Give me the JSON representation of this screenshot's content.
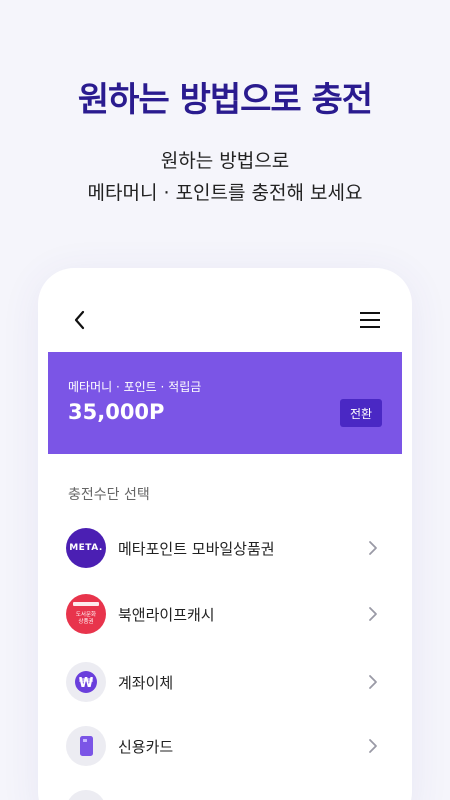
{
  "promo": {
    "headline": "원하는 방법으로 충전",
    "subline1": "원하는 방법으로",
    "subline2": "메타머니 · 포인트를 충전해 보세요"
  },
  "colors": {
    "headline": "#2a1b8f",
    "banner": "#7b55e6",
    "button": "#4a28c4"
  },
  "app": {
    "balance_label": "메타머니 · 포인트 · 적립금",
    "balance_amount": "35,000P",
    "convert_label": "전환",
    "section_title": "충전수단 선택",
    "methods": [
      {
        "label": "메타포인트 모바일상품권",
        "icon": "meta-logo-icon",
        "icon_text": "META."
      },
      {
        "label": "북앤라이프캐시",
        "icon": "book-gift-card-icon",
        "icon_text_1": "도서문화",
        "icon_text_2": "상품권"
      },
      {
        "label": "계좌이체",
        "icon": "won-bank-transfer-icon",
        "icon_text": "₩"
      },
      {
        "label": "신용카드",
        "icon": "credit-card-icon"
      }
    ]
  }
}
